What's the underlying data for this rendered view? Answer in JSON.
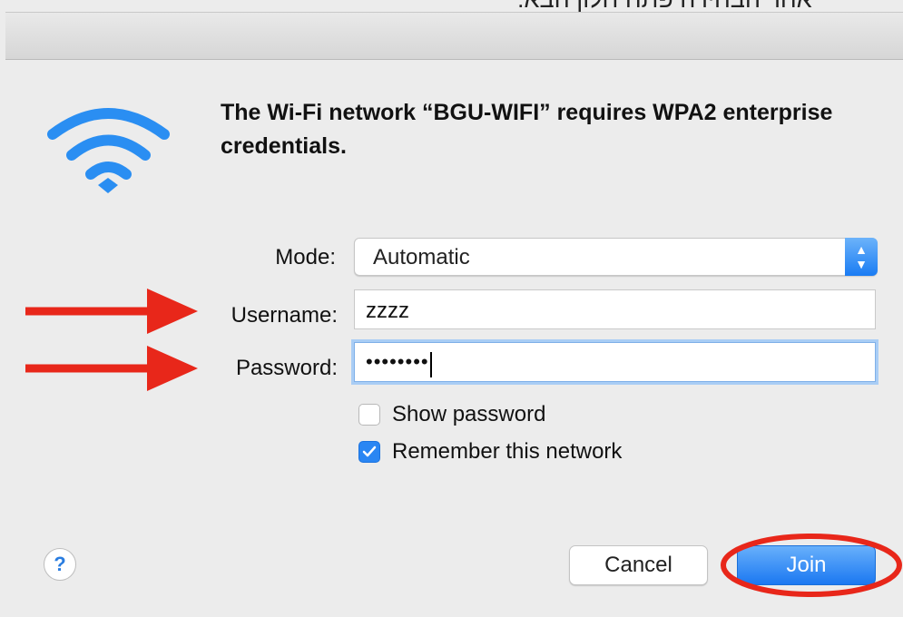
{
  "caption": "אחר הבחירה פתח חלון הבא:",
  "dialog": {
    "message": "The Wi-Fi network “BGU-WIFI” requires WPA2 enterprise credentials.",
    "icon": "wifi-icon"
  },
  "form": {
    "mode_label": "Mode:",
    "mode_value": "Automatic",
    "username_label": "Username:",
    "username_value": "zzzz",
    "password_label": "Password:",
    "password_masked": "••••••••",
    "show_password_label": "Show password",
    "show_password_checked": false,
    "remember_label": "Remember this network",
    "remember_checked": true
  },
  "buttons": {
    "help": "?",
    "cancel": "Cancel",
    "join": "Join"
  },
  "colors": {
    "accent": "#1a7cf3",
    "annotation": "#e8271a"
  }
}
